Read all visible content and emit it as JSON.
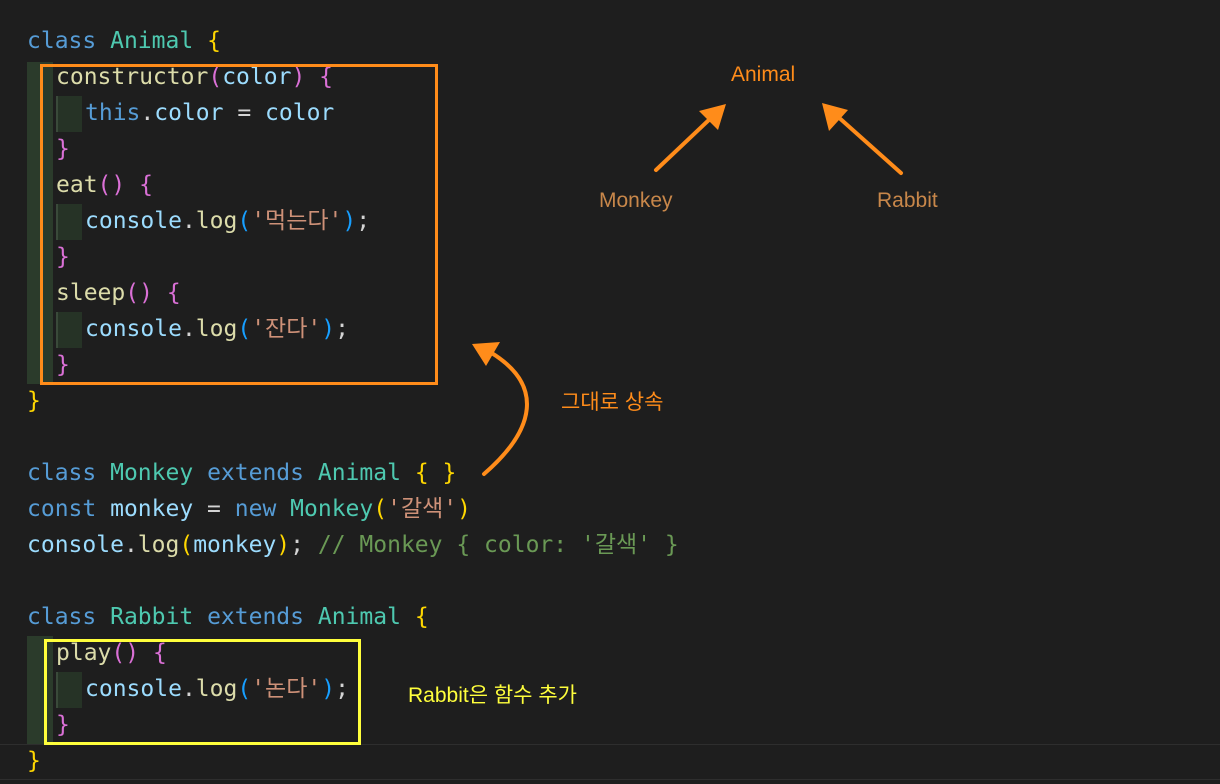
{
  "colors": {
    "background": "#1e1e1e",
    "accent_orange": "#ff8c1a",
    "accent_yellow": "#ffff3c",
    "label_brown": "#c8874a"
  },
  "code": {
    "l1": {
      "kw": "class",
      "cls": "Animal",
      "brace": "{"
    },
    "l2": {
      "fn": "constructor",
      "p_open": "(",
      "param": "color",
      "p_close": ")",
      "brace": "{"
    },
    "l3": {
      "this": "this",
      "dot": ".",
      "prop": "color",
      "eq": " = ",
      "val": "color"
    },
    "l4": {
      "brace": "}"
    },
    "l5": {
      "fn": "eat",
      "parens": "()",
      "brace": "{"
    },
    "l6": {
      "obj": "console",
      "dot": ".",
      "fn": "log",
      "p_open": "(",
      "str": "'먹는다'",
      "p_close": ")",
      "semi": ";"
    },
    "l7": {
      "brace": "}"
    },
    "l8": {
      "fn": "sleep",
      "parens": "()",
      "brace": "{"
    },
    "l9": {
      "obj": "console",
      "dot": ".",
      "fn": "log",
      "p_open": "(",
      "str": "'잔다'",
      "p_close": ")",
      "semi": ";"
    },
    "l10": {
      "brace": "}"
    },
    "l11": {
      "brace": "}"
    },
    "l13": {
      "kw": "class",
      "cls": "Monkey",
      "ext": "extends",
      "parent": "Animal",
      "brace_open": "{",
      "brace_close": "}"
    },
    "l14": {
      "kw": "const",
      "var": "monkey",
      "eq": " = ",
      "new": "new",
      "cls": "Monkey",
      "p_open": "(",
      "str": "'갈색'",
      "p_close": ")"
    },
    "l15": {
      "obj": "console",
      "dot": ".",
      "fn": "log",
      "p_open": "(",
      "arg": "monkey",
      "p_close": ")",
      "semi": ";",
      "comment": "// Monkey { color: '갈색' }"
    },
    "l17": {
      "kw": "class",
      "cls": "Rabbit",
      "ext": "extends",
      "parent": "Animal",
      "brace": "{"
    },
    "l18": {
      "fn": "play",
      "parens": "()",
      "brace": "{"
    },
    "l19": {
      "obj": "console",
      "dot": ".",
      "fn": "log",
      "p_open": "(",
      "str": "'논다'",
      "p_close": ")",
      "semi": ";"
    },
    "l20": {
      "brace": "}"
    },
    "l21": {
      "brace": "}"
    }
  },
  "annotations": {
    "animal": "Animal",
    "monkey": "Monkey",
    "rabbit": "Rabbit",
    "inherit": "그대로 상속",
    "rabbit_note": "Rabbit은 함수 추가"
  }
}
